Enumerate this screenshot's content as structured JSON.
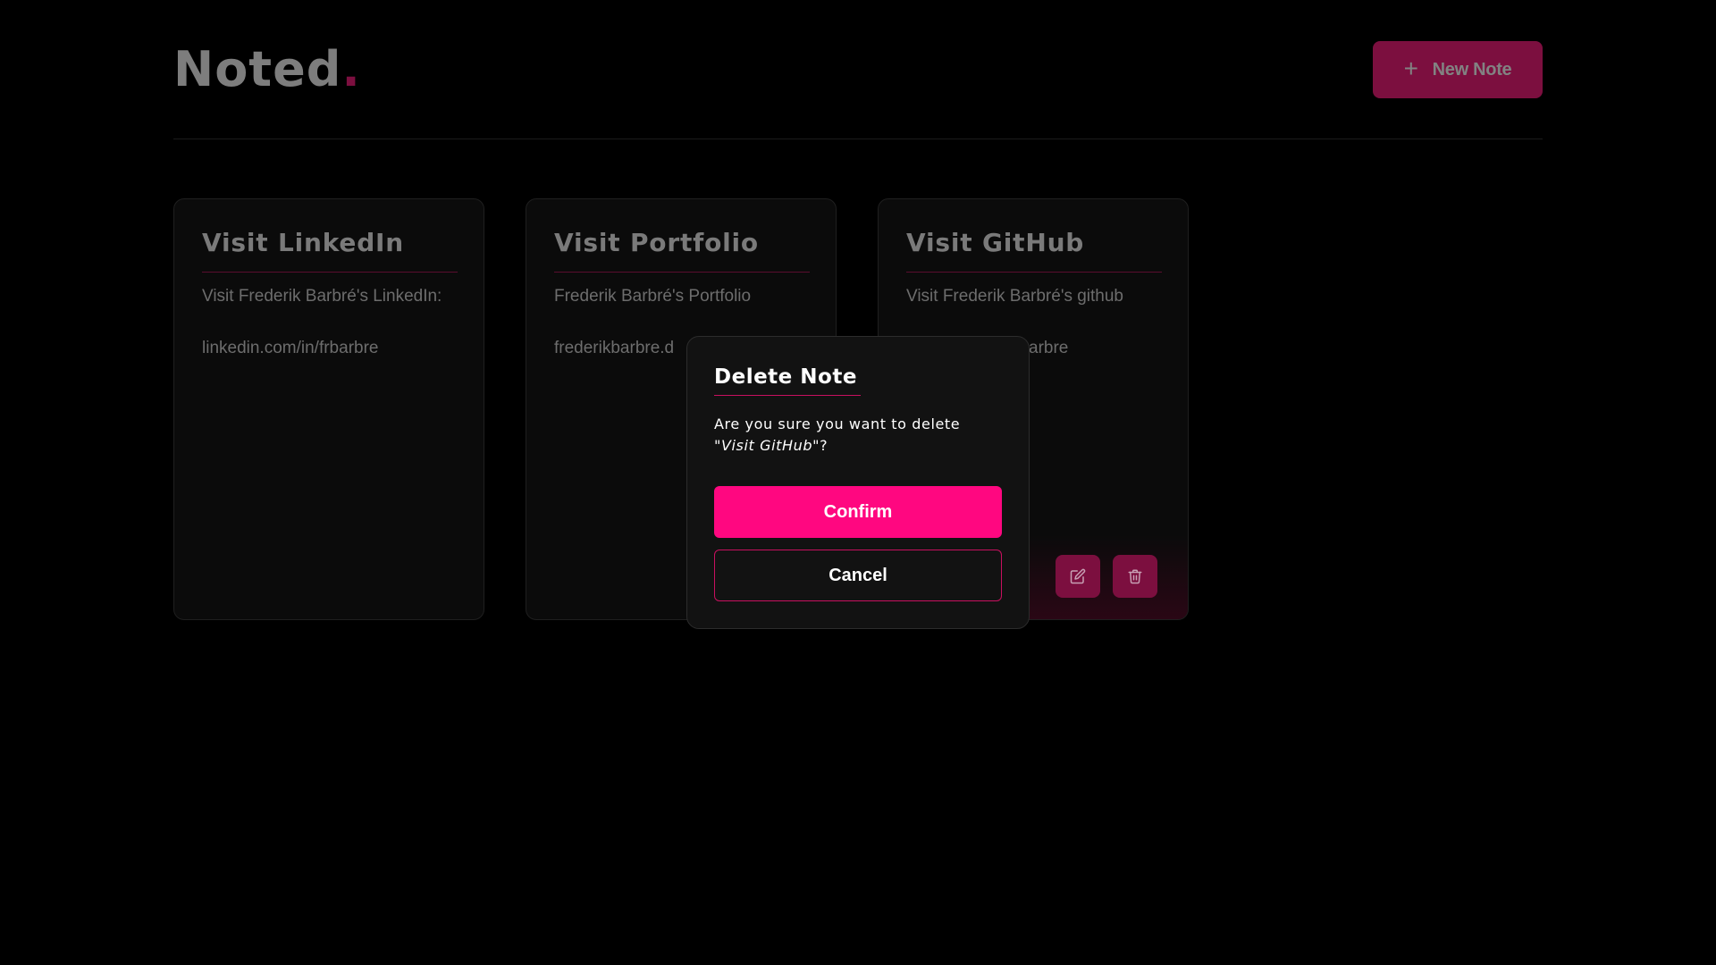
{
  "header": {
    "logo_text": "Noted",
    "logo_dot": ".",
    "new_note_label": "New Note",
    "new_note_icon": "plus-icon"
  },
  "notes": [
    {
      "title": "Visit LinkedIn",
      "line1": "Visit Frederik Barbré's LinkedIn:",
      "line2": "linkedin.com/in/frbarbre"
    },
    {
      "title": "Visit Portfolio",
      "line1": "Frederik Barbré's Portfolio",
      "line2": "frederikbarbre.d"
    },
    {
      "title": "Visit GitHub",
      "line1": "Visit Frederik Barbré's github",
      "line2": "arbre",
      "actions": [
        "edit-icon",
        "trash-icon"
      ]
    }
  ],
  "modal": {
    "title": "Delete Note",
    "message_prefix": "Are you sure you want to delete",
    "note_name": "\"Visit GitHub\"",
    "message_suffix": "?",
    "confirm_label": "Confirm",
    "cancel_label": "Cancel"
  },
  "colors": {
    "background": "#000000",
    "accent": "#ff0780",
    "accent_dim": "#7c0f3f",
    "card_background": "#0b0b0b",
    "modal_background": "#121212"
  }
}
